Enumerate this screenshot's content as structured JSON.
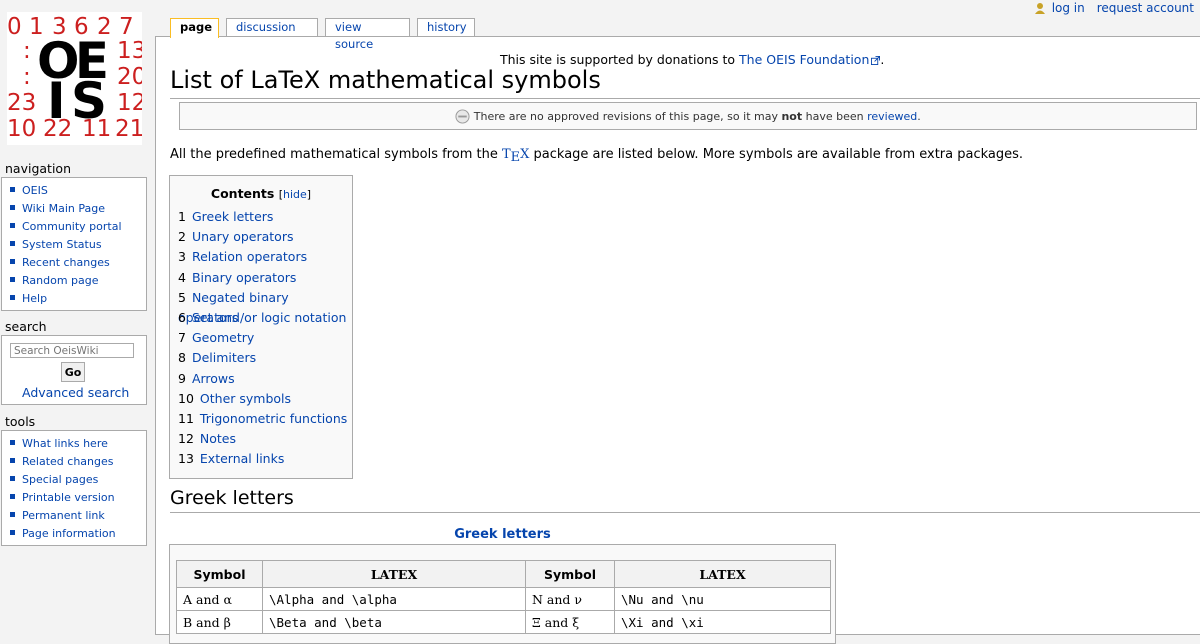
{
  "logo": {
    "alt": "OEIS",
    "top_row": [
      "0",
      "1",
      "3",
      "6",
      "2",
      "7"
    ],
    "right_col": [
      "13",
      "20",
      "12"
    ],
    "left_col": [
      ":",
      ":",
      "23"
    ],
    "bottom_row": [
      "10",
      "22",
      "11",
      "21"
    ],
    "colors": {
      "digits": "#cc1f1f",
      "letters": "#000000"
    }
  },
  "personal": {
    "login": "log in",
    "request": "request account",
    "icon": "user-icon"
  },
  "tabs": [
    {
      "label": "page",
      "selected": true
    },
    {
      "label": "discussion",
      "selected": false
    },
    {
      "label": "view source",
      "selected": false
    },
    {
      "label": "history",
      "selected": false
    }
  ],
  "sitenotice": {
    "text": "This site is supported by donations to ",
    "link": "The OEIS Foundation",
    "end": "."
  },
  "title": "List of LaTeX mathematical symbols",
  "flagged": {
    "pre": "There are no approved revisions of this page, so it may ",
    "bold": "not",
    "mid": " have been ",
    "link": "reviewed",
    "end": "."
  },
  "intro": {
    "pre": "All the predefined mathematical symbols from the ",
    "tex_T": "T",
    "tex_E": "E",
    "tex_X": "X",
    "post": " package are listed below. More symbols are available from extra packages."
  },
  "toc": {
    "title": "Contents",
    "hide_open": "[",
    "hide": "hide",
    "hide_close": "]",
    "items": [
      {
        "num": "1",
        "label": "Greek letters"
      },
      {
        "num": "2",
        "label": "Unary operators"
      },
      {
        "num": "3",
        "label": "Relation operators"
      },
      {
        "num": "4",
        "label": "Binary operators"
      },
      {
        "num": "5",
        "label": "Negated binary operators"
      },
      {
        "num": "6",
        "label": "Set and/or logic notation"
      },
      {
        "num": "7",
        "label": "Geometry"
      },
      {
        "num": "8",
        "label": "Delimiters"
      },
      {
        "num": "9",
        "label": "Arrows"
      },
      {
        "num": "10",
        "label": "Other symbols"
      },
      {
        "num": "11",
        "label": "Trigonometric functions"
      },
      {
        "num": "12",
        "label": "Notes"
      },
      {
        "num": "13",
        "label": "External links"
      }
    ]
  },
  "sidebar": {
    "navigation": {
      "heading": "navigation",
      "items": [
        "OEIS",
        "Wiki Main Page",
        "Community portal",
        "System Status",
        "Recent changes",
        "Random page",
        "Help"
      ]
    },
    "search": {
      "heading": "search",
      "placeholder": "Search OeisWiki",
      "go": "Go",
      "advanced": "Advanced search"
    },
    "tools": {
      "heading": "tools",
      "items": [
        "What links here",
        "Related changes",
        "Special pages",
        "Printable version",
        "Permanent link",
        "Page information"
      ]
    }
  },
  "section": {
    "greek_heading": "Greek letters",
    "caption": "Greek letters"
  },
  "greek_table": {
    "headers": [
      "Symbol",
      "LATEX",
      "Symbol",
      "LATEX"
    ],
    "rows": [
      {
        "s1": "A and α",
        "l1": "\\Alpha and \\alpha",
        "s2": "N and ν",
        "l2": "\\Nu and \\nu"
      },
      {
        "s1": "B and β",
        "l1": "\\Beta and \\beta",
        "s2": "Ξ and ξ",
        "l2": "\\Xi and \\xi"
      }
    ]
  }
}
